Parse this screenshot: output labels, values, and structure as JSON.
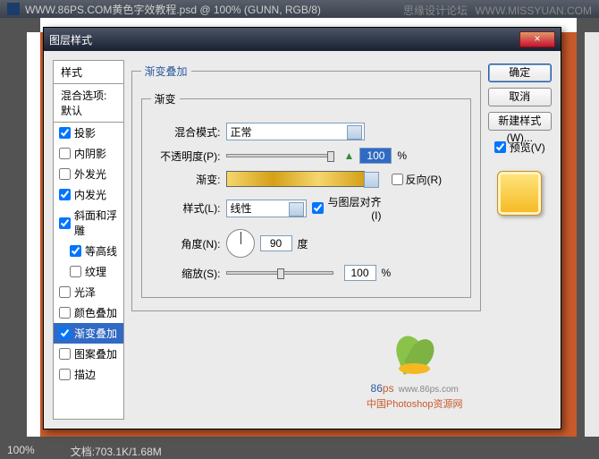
{
  "menubar": {
    "doc_title": "WWW.86PS.COM黄色字效教程.psd @ 100% (GUNN, RGB/8)"
  },
  "watermark": {
    "left": "思缘设计论坛",
    "right": "WWW.MISSYUAN.COM"
  },
  "statusbar": {
    "zoom": "100%",
    "doc_info": "文档:703.1K/1.68M"
  },
  "dialog": {
    "title": "图层样式",
    "close": "×",
    "styles_header": "样式",
    "blend_header": "混合选项:默认",
    "items": [
      {
        "label": "投影",
        "checked": true
      },
      {
        "label": "内阴影",
        "checked": false
      },
      {
        "label": "外发光",
        "checked": false
      },
      {
        "label": "内发光",
        "checked": true
      },
      {
        "label": "斜面和浮雕",
        "checked": true
      },
      {
        "label": "等高线",
        "checked": true,
        "indent": true
      },
      {
        "label": "纹理",
        "checked": false,
        "indent": true
      },
      {
        "label": "光泽",
        "checked": false
      },
      {
        "label": "颜色叠加",
        "checked": false
      },
      {
        "label": "渐变叠加",
        "checked": true,
        "selected": true
      },
      {
        "label": "图案叠加",
        "checked": false
      },
      {
        "label": "描边",
        "checked": false
      }
    ],
    "group_title": "渐变叠加",
    "inner_title": "渐变",
    "labels": {
      "blend_mode": "混合模式:",
      "blend_val": "正常",
      "opacity": "不透明度(P):",
      "opacity_val": "100",
      "pct": "%",
      "gradient": "渐变:",
      "reverse": "反向(R)",
      "style": "样式(L):",
      "style_val": "线性",
      "align": "与图层对齐(I)",
      "angle": "角度(N):",
      "angle_val": "90",
      "deg": "度",
      "scale": "缩放(S):",
      "scale_val": "100"
    },
    "buttons": {
      "ok": "确定",
      "cancel": "取消",
      "new_style": "新建样式(W)...",
      "preview": "预览(V)"
    }
  },
  "logo": {
    "brand": "86",
    "ps": "ps",
    "url": "www.86ps.com",
    "tag": "中国Photoshop资源网"
  }
}
